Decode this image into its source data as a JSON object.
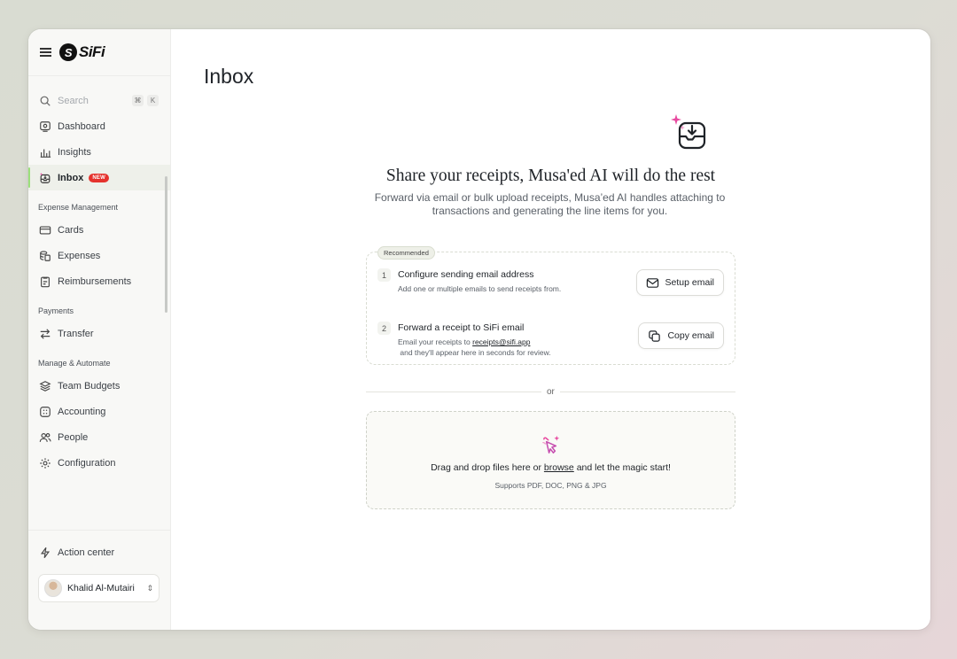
{
  "brand": {
    "name": "SiFi",
    "logo_mark": "S"
  },
  "sidebar": {
    "search": {
      "label": "Search",
      "shortcut": [
        "⌘",
        "K"
      ]
    },
    "items_top": [
      {
        "label": "Dashboard",
        "icon": "dashboard-icon"
      },
      {
        "label": "Insights",
        "icon": "insights-icon"
      },
      {
        "label": "Inbox",
        "icon": "inbox-icon",
        "badge": "NEW",
        "active": true
      }
    ],
    "sections": [
      {
        "title": "Expense Management",
        "items": [
          {
            "label": "Cards"
          },
          {
            "label": "Expenses"
          },
          {
            "label": "Reimbursements"
          }
        ]
      },
      {
        "title": "Payments",
        "items": [
          {
            "label": "Transfer"
          }
        ]
      },
      {
        "title": "Manage & Automate",
        "items": [
          {
            "label": "Team Budgets"
          },
          {
            "label": "Accounting"
          },
          {
            "label": "People"
          },
          {
            "label": "Configuration"
          }
        ]
      }
    ],
    "action_center": "Action center",
    "user": {
      "name": "Khalid Al-Mutairi"
    }
  },
  "main": {
    "title": "Inbox",
    "hero": {
      "title": "Share your receipts, Musa'ed AI will do the rest",
      "subtitle": "Forward via email or bulk upload receipts, Musa’ed AI handles attaching to transactions and generating the line items for you."
    },
    "card": {
      "badge": "Recommended",
      "steps": [
        {
          "num": "1",
          "title": "Configure sending email address",
          "desc": "Add one or multiple emails to send receipts from.",
          "button": "Setup email"
        },
        {
          "num": "2",
          "title": "Forward a receipt to SiFi email",
          "desc_prefix": "Email your receipts to",
          "email": "receipts@sifi.app",
          "desc_suffix": "and they'll appear here in seconds for review.",
          "button": "Copy email"
        }
      ]
    },
    "divider": "or",
    "dropzone": {
      "text_before": "Drag and drop files here or",
      "link": "browse",
      "text_after": "and let the magic start!",
      "formats": "Supports PDF, DOC, PNG & JPG"
    }
  },
  "colors": {
    "accent_green": "#9be07b",
    "badge_red": "#e5322d",
    "sparkle_pink": "#e84aa0"
  }
}
